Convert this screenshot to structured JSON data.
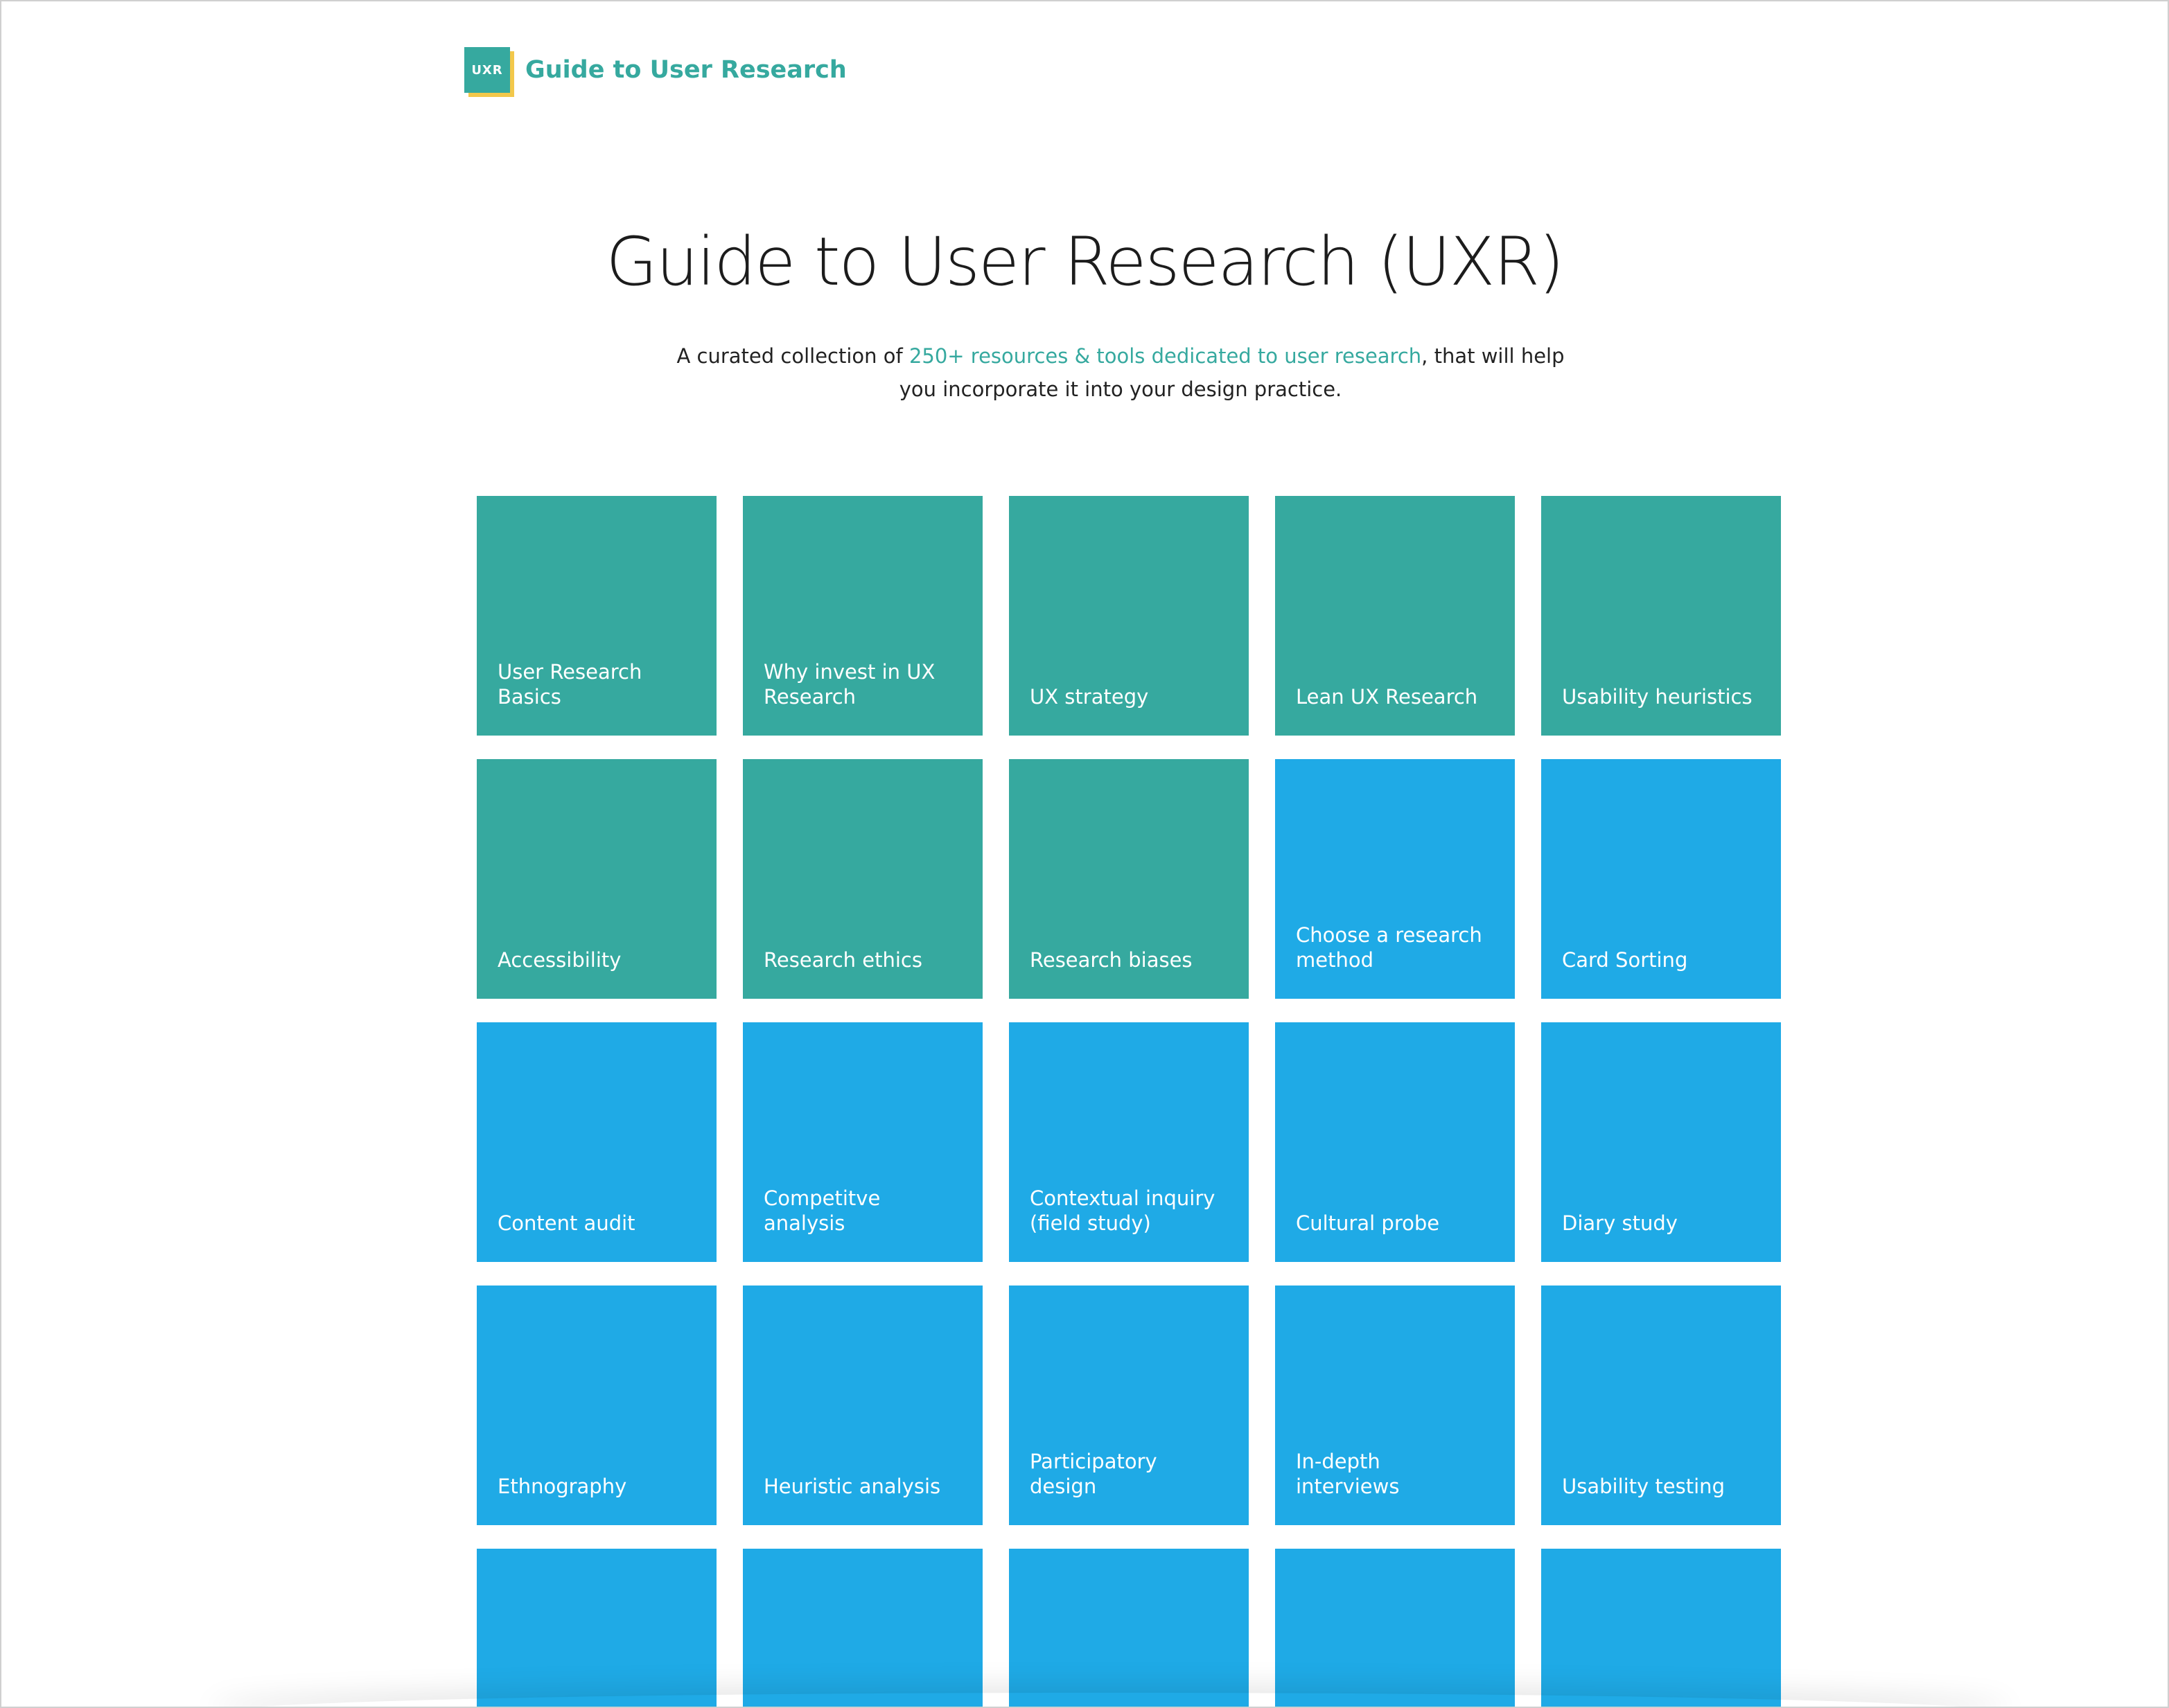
{
  "header": {
    "logo_text": "UXR",
    "site_title": "Guide to User Research"
  },
  "hero": {
    "title": "Guide to User Research (UXR)",
    "subtitle_pre": "A curated collection of ",
    "subtitle_link": "250+ resources & tools dedicated to user research",
    "subtitle_post": ",  that will help you incorporate it into your design practice."
  },
  "colors": {
    "teal": "#36a99f",
    "blue": "#1faae6",
    "logo_accent": "#f2c84b"
  },
  "tiles": [
    {
      "label": "User Research Basics",
      "color": "teal"
    },
    {
      "label": "Why invest in UX Research",
      "color": "teal"
    },
    {
      "label": "UX strategy",
      "color": "teal"
    },
    {
      "label": "Lean UX Research",
      "color": "teal"
    },
    {
      "label": "Usability heuristics",
      "color": "teal"
    },
    {
      "label": "Accessibility",
      "color": "teal"
    },
    {
      "label": "Research ethics",
      "color": "teal"
    },
    {
      "label": "Research biases",
      "color": "teal"
    },
    {
      "label": "Choose a research method",
      "color": "blue"
    },
    {
      "label": "Card Sorting",
      "color": "blue"
    },
    {
      "label": "Content audit",
      "color": "blue"
    },
    {
      "label": "Competitve analysis",
      "color": "blue"
    },
    {
      "label": "Contextual inquiry (field study)",
      "color": "blue"
    },
    {
      "label": "Cultural probe",
      "color": "blue"
    },
    {
      "label": "Diary study",
      "color": "blue"
    },
    {
      "label": "Ethnography",
      "color": "blue"
    },
    {
      "label": "Heuristic analysis",
      "color": "blue"
    },
    {
      "label": "Participatory design",
      "color": "blue"
    },
    {
      "label": "In-depth interviews",
      "color": "blue"
    },
    {
      "label": "Usability testing",
      "color": "blue"
    },
    {
      "label": "",
      "color": "blue"
    },
    {
      "label": "",
      "color": "blue"
    },
    {
      "label": "",
      "color": "blue"
    },
    {
      "label": "",
      "color": "blue"
    },
    {
      "label": "",
      "color": "blue"
    }
  ]
}
